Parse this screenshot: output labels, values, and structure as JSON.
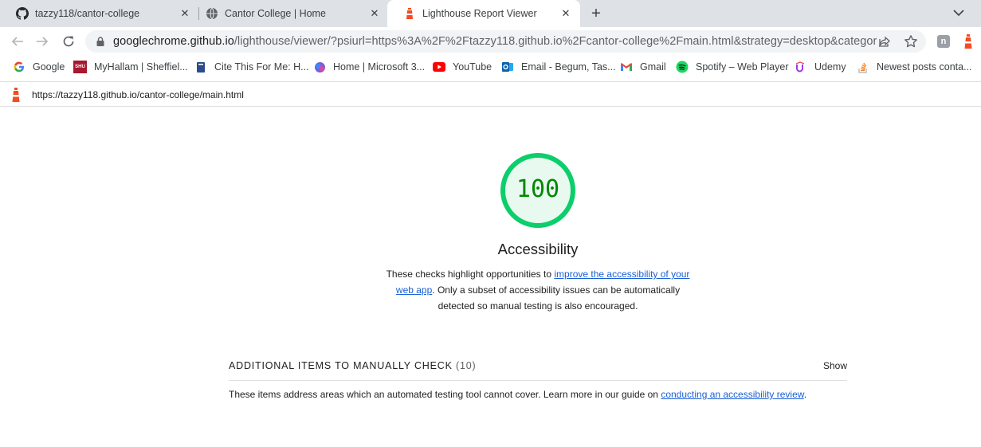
{
  "tabs": [
    {
      "title": "tazzy118/cantor-college",
      "icon": "github-icon",
      "active": false
    },
    {
      "title": "Cantor College | Home",
      "icon": "globe-icon",
      "active": false
    },
    {
      "title": "Lighthouse Report Viewer",
      "icon": "lighthouse-icon",
      "active": true
    }
  ],
  "toolbar": {
    "url_host": "googlechrome.github.io",
    "url_rest": "/lighthouse/viewer/?psiurl=https%3A%2F%2Ftazzy118.github.io%2Fcantor-college%2Fmain.html&strategy=desktop&category=..."
  },
  "bookmarks": [
    {
      "label": "Google",
      "icon": "google-icon"
    },
    {
      "label": "MyHallam | Sheffiel...",
      "icon": "shu-icon"
    },
    {
      "label": "Cite This For Me: H...",
      "icon": "cite-icon"
    },
    {
      "label": "Home | Microsoft 3...",
      "icon": "microsoft365-icon"
    },
    {
      "label": "YouTube",
      "icon": "youtube-icon"
    },
    {
      "label": "Email - Begum, Tas...",
      "icon": "outlook-icon"
    },
    {
      "label": "Gmail",
      "icon": "gmail-icon"
    },
    {
      "label": "Spotify – Web Player",
      "icon": "spotify-icon"
    },
    {
      "label": "Udemy",
      "icon": "udemy-icon"
    },
    {
      "label": "Newest posts conta...",
      "icon": "stackoverflow-icon"
    }
  ],
  "report": {
    "url": "https://tazzy118.github.io/cantor-college/main.html",
    "score": "100",
    "score_fraction": 1.0,
    "score_color": "#0cce6b",
    "category_title": "Accessibility",
    "desc_before": "These checks highlight opportunities to ",
    "desc_link": "improve the accessibility of your web app",
    "desc_after": ". Only a subset of accessibility issues can be automatically detected so manual testing is also encouraged.",
    "manual_label": "ADDITIONAL ITEMS TO MANUALLY CHECK",
    "manual_count": "(10)",
    "show_label": "Show",
    "manual_desc_before": "These items address areas which an automated testing tool cannot cover. Learn more in our guide on ",
    "manual_desc_link": "conducting an accessibility review",
    "manual_desc_after": "."
  }
}
